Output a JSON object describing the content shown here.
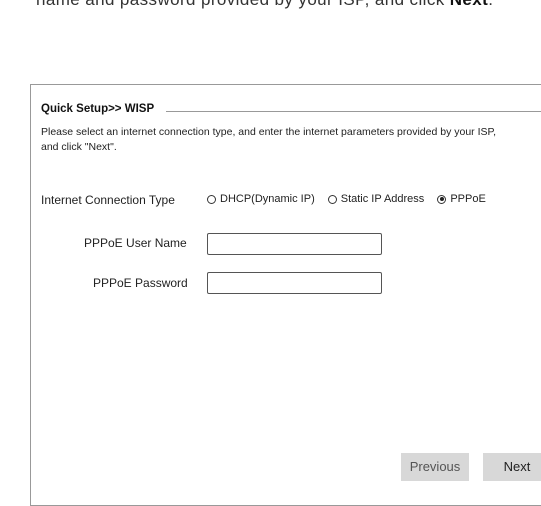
{
  "doc": {
    "text_before": "name and password provided by your ISP, and click ",
    "text_bold": "Next",
    "text_after": "."
  },
  "panel": {
    "title": "Quick Setup>> WISP",
    "description_line1": "Please select an internet connection type, and enter the internet parameters provided by your ISP,",
    "description_line2": "and click \"Next\"."
  },
  "connection": {
    "label": "Internet Connection Type",
    "options": [
      {
        "label": "DHCP(Dynamic IP)",
        "checked": false
      },
      {
        "label": "Static IP Address",
        "checked": false
      },
      {
        "label": "PPPoE",
        "checked": true
      }
    ]
  },
  "pppoe": {
    "user_label": "PPPoE User Name",
    "user_value": "",
    "password_label": "PPPoE Password",
    "password_value": ""
  },
  "buttons": {
    "previous": "Previous",
    "next": "Next"
  }
}
